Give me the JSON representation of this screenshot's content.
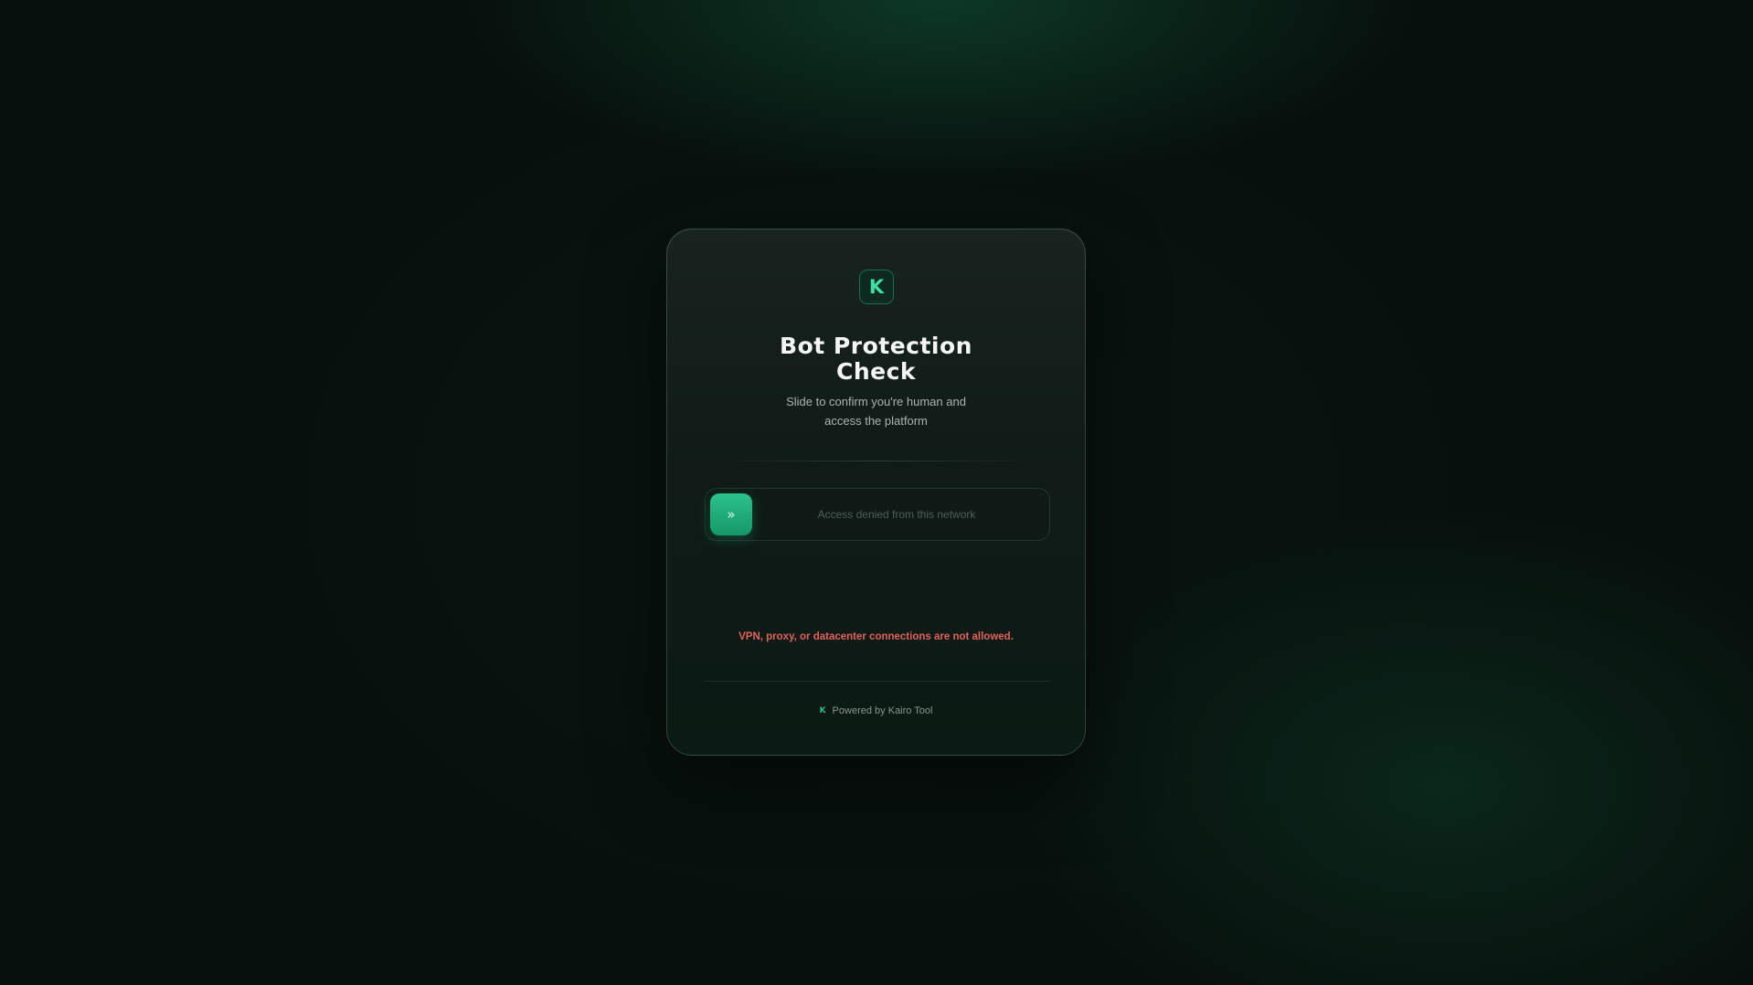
{
  "logo": {
    "glyph": "K",
    "icon": "kairo-logo-icon"
  },
  "title": "Bot Protection Check",
  "subtitle": "Slide to confirm you're human and access the platform",
  "slider": {
    "handle_icon": "chevrons-right-icon",
    "handle_glyph": "»",
    "status_text": "Access denied from this network",
    "progress": 0
  },
  "error_message": "VPN, proxy, or datacenter connections are not allowed.",
  "footer": {
    "icon_glyph": "K",
    "text": "Powered by Kairo Tool"
  },
  "colors": {
    "accent": "#2cc28c",
    "error": "#e0635b",
    "background": "#07100d"
  }
}
